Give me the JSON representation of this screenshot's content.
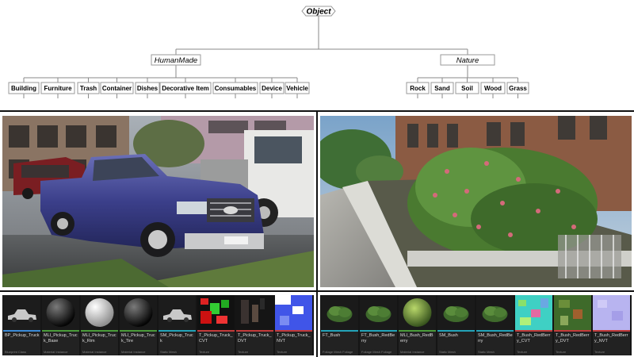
{
  "taxonomy": {
    "root": "Object",
    "groups": [
      {
        "label": "HumanMade",
        "children": [
          "Building",
          "Furniture",
          "Trash",
          "Container",
          "Dishes",
          "Decorative Item",
          "Consumables",
          "Device",
          "Vehicle"
        ]
      },
      {
        "label": "Nature",
        "children": [
          "Rock",
          "Sand",
          "Soil",
          "Wood",
          "Grass"
        ]
      }
    ]
  },
  "assets_left": [
    {
      "name": "BP_Pickup_Truck",
      "type": "Blueprint Class",
      "bar": "#3b8ad6",
      "thumb": "truck"
    },
    {
      "name": "MLI_Pickup_Truck_Base",
      "type": "Material Instance",
      "bar": "#4a9a3a",
      "thumb": "sphere-dark"
    },
    {
      "name": "MLI_Pickup_Truck_Rim",
      "type": "Material Instance",
      "bar": "#4a9a3a",
      "thumb": "sphere-light"
    },
    {
      "name": "MLI_Pickup_Truck_Tire",
      "type": "Material Instance",
      "bar": "#4a9a3a",
      "thumb": "sphere-dark"
    },
    {
      "name": "SM_Pickup_Truck",
      "type": "Static Mesh",
      "bar": "#23a3b8",
      "thumb": "truck"
    },
    {
      "name": "T_Pickup_Truck_CVT",
      "type": "Texture",
      "bar": "#c23b3b",
      "thumb": "tex-red"
    },
    {
      "name": "T_Pickup_Truck_DVT",
      "type": "Texture",
      "bar": "#c23b3b",
      "thumb": "tex-dark"
    },
    {
      "name": "T_Pickup_Truck_NVT",
      "type": "Texture",
      "bar": "#c23b3b",
      "thumb": "tex-blue"
    }
  ],
  "assets_right": [
    {
      "name": "FT_Bush",
      "type": "Foliage Mesh Foliage",
      "bar": "#23a3b8",
      "thumb": "bush"
    },
    {
      "name": "FT_Bush_RedBerry",
      "type": "Foliage Mesh Foliage",
      "bar": "#23a3b8",
      "thumb": "bush"
    },
    {
      "name": "MLI_Bush_RedBerry",
      "type": "Material Instance",
      "bar": "#4a9a3a",
      "thumb": "sphere-green"
    },
    {
      "name": "SM_Bush",
      "type": "Static Mesh",
      "bar": "#23a3b8",
      "thumb": "bush"
    },
    {
      "name": "SM_Bush_RedBerry",
      "type": "Static Mesh",
      "bar": "#23a3b8",
      "thumb": "bush"
    },
    {
      "name": "T_Bush_RedBerry_CVT",
      "type": "Texture",
      "bar": "#c23b3b",
      "thumb": "tex-cyan"
    },
    {
      "name": "T_Bush_RedBerry_DVT",
      "type": "Texture",
      "bar": "#c23b3b",
      "thumb": "tex-green"
    },
    {
      "name": "T_Bush_RedBerry_NVT",
      "type": "Texture",
      "bar": "#c23b3b",
      "thumb": "tex-lilac"
    }
  ]
}
